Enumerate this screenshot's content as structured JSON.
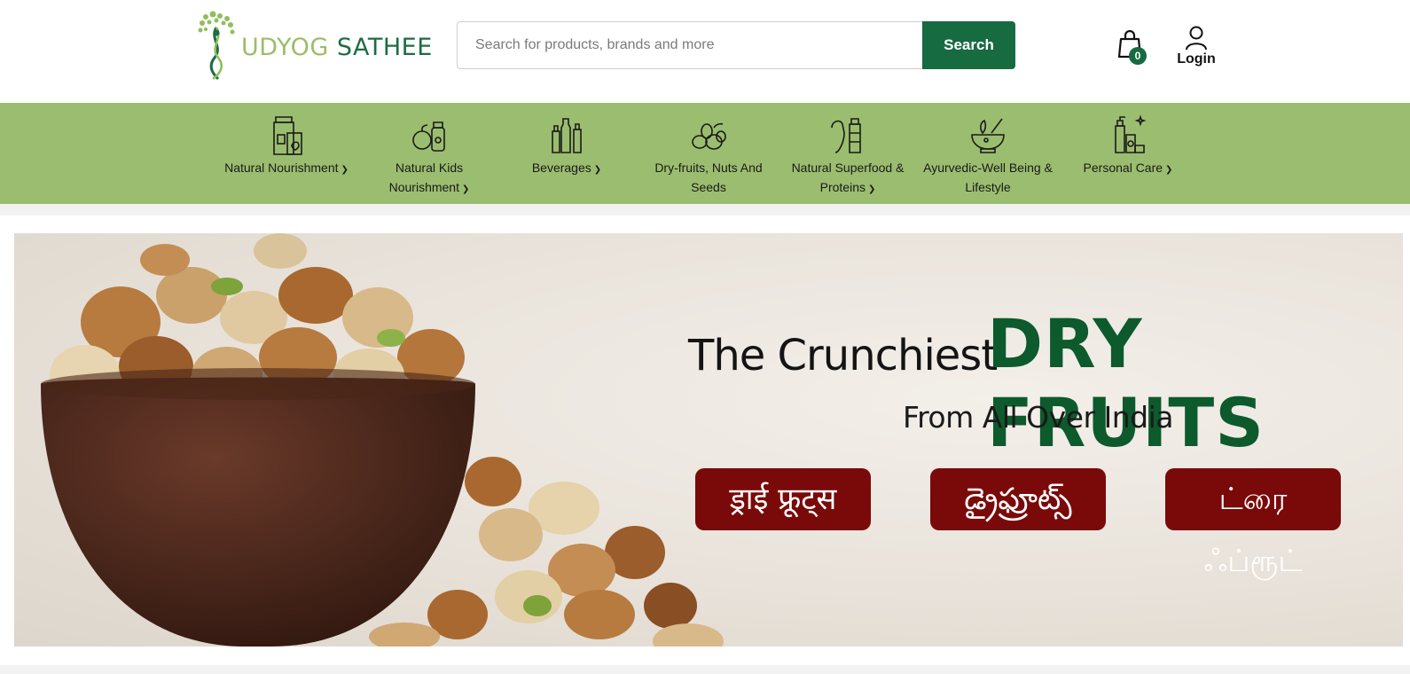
{
  "brand": {
    "word1": "UDYOG",
    "word2": "SATHEE"
  },
  "search": {
    "placeholder": "Search for products, brands and more",
    "button_label": "Search"
  },
  "cart": {
    "count": "0"
  },
  "account": {
    "login_label": "Login"
  },
  "categories": [
    {
      "line1": "Natural Nourishment",
      "line2": "",
      "icon": "grocery-jar-icon",
      "has_dropdown": true
    },
    {
      "line1": "Natural Kids",
      "line2": "Nourishment",
      "icon": "kids-food-icon",
      "has_dropdown": true
    },
    {
      "line1": "Beverages",
      "line2": "",
      "icon": "bottles-icon",
      "has_dropdown": true
    },
    {
      "line1": "Dry-fruits, Nuts And",
      "line2": "Seeds",
      "icon": "nuts-icon",
      "has_dropdown": false
    },
    {
      "line1": "Natural Superfood &",
      "line2": "Proteins",
      "icon": "protein-icon",
      "has_dropdown": true
    },
    {
      "line1": "Ayurvedic-Well Being &",
      "line2": "Lifestyle",
      "icon": "mortar-pestle-icon",
      "has_dropdown": false
    },
    {
      "line1": "Personal Care",
      "line2": "",
      "icon": "personal-care-icon",
      "has_dropdown": true
    }
  ],
  "banner": {
    "title_prefix": "The Crunchiest",
    "title_highlight": "DRY FRUITS",
    "subtitle": "From All Over India",
    "languages": [
      "ड्राई फ्रूट्स",
      "డ్రైఫ్రూట్స్",
      "ட்ரை ஃப்ரூட்"
    ]
  },
  "colors": {
    "brand_green": "#166b41",
    "nav_green": "#9bbd6f",
    "pill_red": "#7a0a0a"
  }
}
